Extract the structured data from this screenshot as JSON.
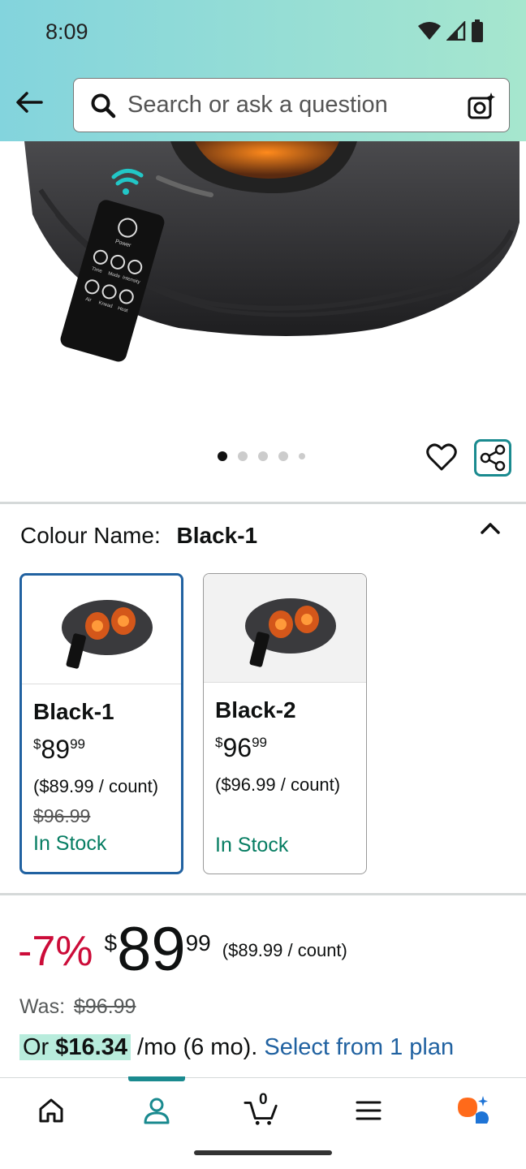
{
  "status": {
    "time": "8:09"
  },
  "search": {
    "placeholder": "Search or ask a question"
  },
  "gallery": {
    "remote_labels": [
      "Power",
      "Time",
      "Mode",
      "Intensity",
      "Air",
      "Knead",
      "Heat"
    ]
  },
  "variation": {
    "label": "Colour Name:",
    "selected": "Black-1",
    "options": [
      {
        "name": "Black-1",
        "currency": "$",
        "price_whole": "89",
        "price_cents": "99",
        "unit_price": "($89.99 / count)",
        "was": "$96.99",
        "stock": "In Stock"
      },
      {
        "name": "Black-2",
        "currency": "$",
        "price_whole": "96",
        "price_cents": "99",
        "unit_price": "($96.99 / count)",
        "was": "",
        "stock": "In Stock"
      }
    ]
  },
  "price": {
    "discount": "-7%",
    "currency": "$",
    "whole": "89",
    "cents": "99",
    "unit": "($89.99 / count)",
    "was_label": "Was:",
    "was_value": "$96.99",
    "installment_prefix": "Or",
    "installment_amount": "$16.34",
    "installment_suffix": "/mo (6 mo).",
    "installment_link": "Select from 1 plan"
  },
  "nav": {
    "cart_count": "0"
  },
  "colors": {
    "accent": "#1a8a8f",
    "link": "#2162a1",
    "discount": "#cc0c39",
    "stock": "#067d62"
  }
}
